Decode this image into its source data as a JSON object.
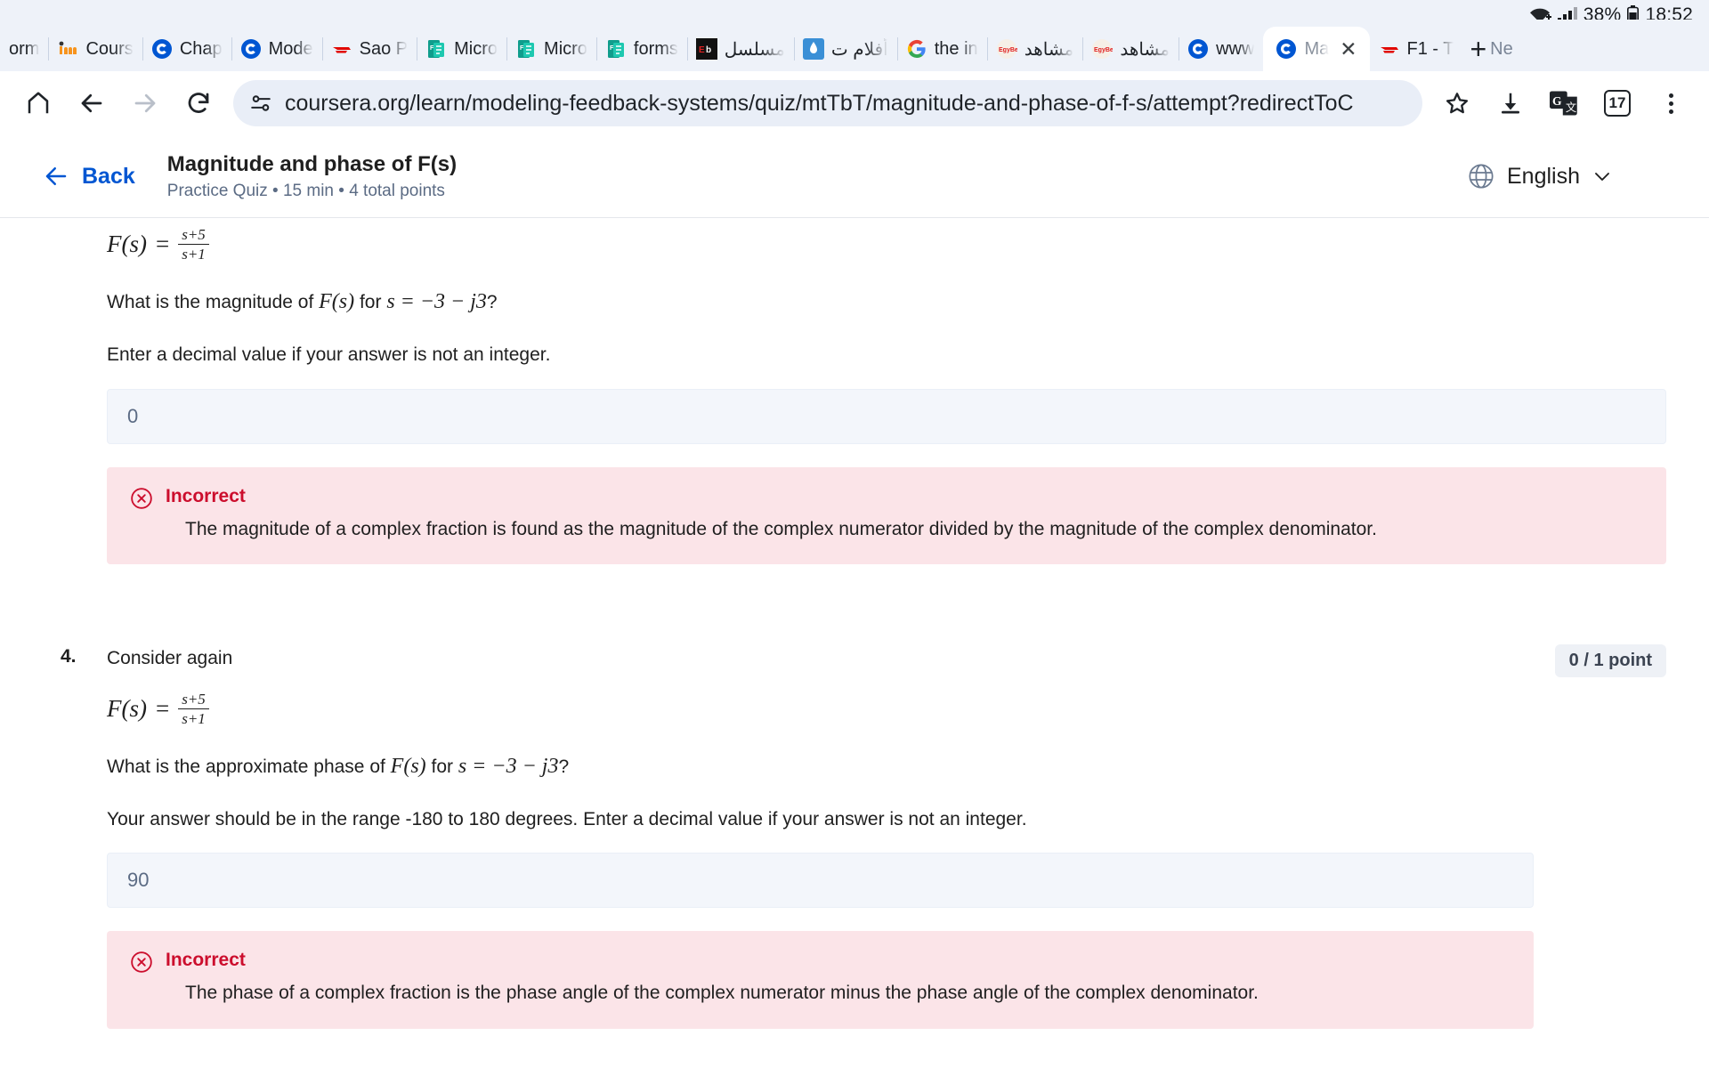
{
  "status_bar": {
    "battery_percent": "38%",
    "time": "18:52",
    "icons": [
      "wifi-icon",
      "signal-icon",
      "battery-icon"
    ]
  },
  "tabs": [
    {
      "label": "orm",
      "favicon": "forms-icon",
      "active": false,
      "rtl": false
    },
    {
      "label": "Cours",
      "favicon": "moodle-icon",
      "active": false,
      "rtl": false
    },
    {
      "label": "Chap",
      "favicon": "coursera-icon",
      "active": false,
      "rtl": false
    },
    {
      "label": "Mode",
      "favicon": "coursera-icon",
      "active": false,
      "rtl": false
    },
    {
      "label": "Sao P",
      "favicon": "f1-icon",
      "active": false,
      "rtl": false
    },
    {
      "label": "Micro",
      "favicon": "forms-icon",
      "active": false,
      "rtl": false
    },
    {
      "label": "Micro",
      "favicon": "forms-icon",
      "active": false,
      "rtl": false
    },
    {
      "label": "forms",
      "favicon": "forms-icon",
      "active": false,
      "rtl": false
    },
    {
      "label": "مسلسل",
      "favicon": "egybest-icon",
      "active": false,
      "rtl": true
    },
    {
      "label": "أفلام ت",
      "favicon": "aljazeera-icon",
      "active": false,
      "rtl": true
    },
    {
      "label": "the in",
      "favicon": "google-icon",
      "active": false,
      "rtl": false
    },
    {
      "label": "مشاهد",
      "favicon": "egybest-icon",
      "active": false,
      "rtl": true
    },
    {
      "label": "مشاهد",
      "favicon": "egybest-icon",
      "active": false,
      "rtl": true
    },
    {
      "label": "www",
      "favicon": "coursera-icon",
      "active": false,
      "rtl": false
    },
    {
      "label": "Ma",
      "favicon": "coursera-icon",
      "active": true,
      "rtl": false
    },
    {
      "label": "F1 - T",
      "favicon": "f1-icon",
      "active": false,
      "rtl": false
    }
  ],
  "new_tab": {
    "plus": "+",
    "label": "Ne"
  },
  "toolbar": {
    "home_icon": "home-icon",
    "back_icon": "back-arrow-icon",
    "forward_icon": "forward-arrow-icon",
    "reload_icon": "reload-icon",
    "site_info_icon": "site-settings-icon",
    "url": "coursera.org/learn/modeling-feedback-systems/quiz/mtTbT/magnitude-and-phase-of-f-s/attempt?redirectToC",
    "bookmark_icon": "star-icon",
    "download_icon": "download-icon",
    "translate_icon": "google-translate-icon",
    "tab_count": "17",
    "menu_icon": "kebab-menu-icon"
  },
  "header": {
    "back_label": "Back",
    "back_icon": "arrow-left-icon",
    "title": "Magnitude and phase of F(s)",
    "subtitle": "Practice Quiz • 15 min • 4 total points",
    "language_label": "English",
    "globe_icon": "globe-icon",
    "chevron_icon": "chevron-down-icon"
  },
  "questions": [
    {
      "number": "",
      "formula": {
        "lhs": "F(s)",
        "eq": "=",
        "numerator": "s+5",
        "denominator": "s+1"
      },
      "prompt_pre": "What is the magnitude of ",
      "prompt_fn": "F(s)",
      "prompt_mid": " for ",
      "prompt_expr": "s = −3 − j3",
      "prompt_post": "?",
      "hint": "Enter a decimal value if your answer is not an integer.",
      "answer_value": "0",
      "points": "",
      "feedback": {
        "icon": "x-circle-icon",
        "title": "Incorrect",
        "text": "The magnitude of a complex fraction is found as the magnitude of the complex numerator divided by the magnitude of the complex denominator."
      }
    },
    {
      "number": "4.",
      "intro": "Consider again",
      "formula": {
        "lhs": "F(s)",
        "eq": "=",
        "numerator": "s+5",
        "denominator": "s+1"
      },
      "prompt_pre": "What is the approximate phase of ",
      "prompt_fn": "F(s)",
      "prompt_mid": " for ",
      "prompt_expr": "s = −3 − j3",
      "prompt_post": "?",
      "hint": "Your answer should be in the range -180 to 180 degrees. Enter a decimal value if your answer is not an integer.",
      "answer_value": "90",
      "points": "0 / 1 point",
      "feedback": {
        "icon": "x-circle-icon",
        "title": "Incorrect",
        "text": "The phase of a complex fraction is the phase angle of the complex numerator minus the phase angle of the complex denominator."
      }
    }
  ],
  "colors": {
    "coursera_blue": "#0056d2",
    "error_red": "#cc0e2d",
    "error_bg": "#fbe4e8",
    "input_bg": "#f3f6fb",
    "chrome_bg": "#eef2f9"
  }
}
